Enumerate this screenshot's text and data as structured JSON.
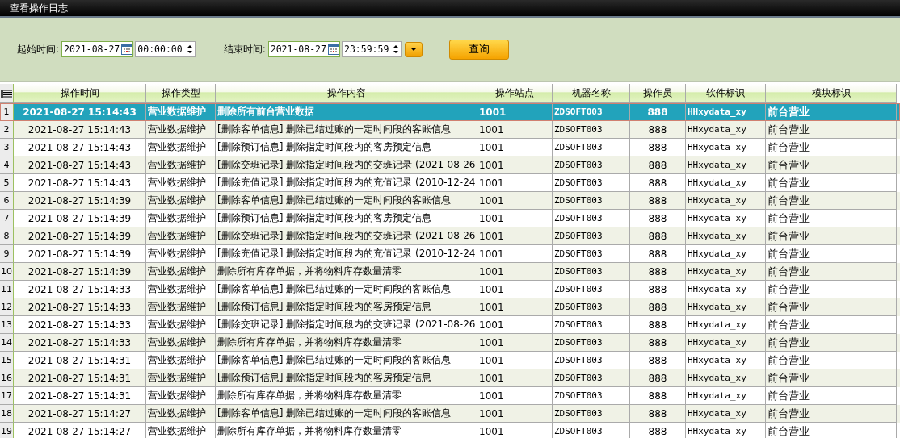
{
  "window": {
    "title": "查看操作日志"
  },
  "filter": {
    "start_label": "起始时间:",
    "start_date": "2021-08-27",
    "start_time": "00:00:00",
    "end_label": "结束时间:",
    "end_date": "2021-08-27",
    "end_time": "23:59:59",
    "query_button": "查询"
  },
  "table": {
    "columns": [
      "操作时间",
      "操作类型",
      "操作内容",
      "操作站点",
      "机器名称",
      "操作员",
      "软件标识",
      "模块标识"
    ],
    "rows": [
      {
        "num": "1",
        "selected": true,
        "cells": [
          "2021-08-27  15:14:43",
          "营业数据维护",
          "删除所有前台营业数据",
          "1001",
          "ZDSOFT003",
          "888",
          "HHxydata_xy",
          "前台营业"
        ]
      },
      {
        "num": "2",
        "selected": false,
        "cells": [
          "2021-08-27  15:14:43",
          "营业数据维护",
          "[删除客单信息] 删除已结过账的一定时间段的客账信息",
          "1001",
          "ZDSOFT003",
          "888",
          "HHxydata_xy",
          "前台营业"
        ]
      },
      {
        "num": "3",
        "selected": false,
        "cells": [
          "2021-08-27  15:14:43",
          "营业数据维护",
          "[删除预订信息] 删除指定时间段内的客房预定信息",
          "1001",
          "ZDSOFT003",
          "888",
          "HHxydata_xy",
          "前台营业"
        ]
      },
      {
        "num": "4",
        "selected": false,
        "cells": [
          "2021-08-27  15:14:43",
          "营业数据维护",
          "[删除交班记录] 删除指定时间段内的交班记录 (2021-08-26",
          "1001",
          "ZDSOFT003",
          "888",
          "HHxydata_xy",
          "前台营业"
        ]
      },
      {
        "num": "5",
        "selected": false,
        "cells": [
          "2021-08-27  15:14:43",
          "营业数据维护",
          "[删除充值记录] 删除指定时间段内的充值记录 (2010-12-24",
          "1001",
          "ZDSOFT003",
          "888",
          "HHxydata_xy",
          "前台营业"
        ]
      },
      {
        "num": "6",
        "selected": false,
        "cells": [
          "2021-08-27  15:14:39",
          "营业数据维护",
          "[删除客单信息] 删除已结过账的一定时间段的客账信息",
          "1001",
          "ZDSOFT003",
          "888",
          "HHxydata_xy",
          "前台营业"
        ]
      },
      {
        "num": "7",
        "selected": false,
        "cells": [
          "2021-08-27  15:14:39",
          "营业数据维护",
          "[删除预订信息] 删除指定时间段内的客房预定信息",
          "1001",
          "ZDSOFT003",
          "888",
          "HHxydata_xy",
          "前台营业"
        ]
      },
      {
        "num": "8",
        "selected": false,
        "cells": [
          "2021-08-27  15:14:39",
          "营业数据维护",
          "[删除交班记录] 删除指定时间段内的交班记录 (2021-08-26",
          "1001",
          "ZDSOFT003",
          "888",
          "HHxydata_xy",
          "前台营业"
        ]
      },
      {
        "num": "9",
        "selected": false,
        "cells": [
          "2021-08-27  15:14:39",
          "营业数据维护",
          "[删除充值记录] 删除指定时间段内的充值记录 (2010-12-24",
          "1001",
          "ZDSOFT003",
          "888",
          "HHxydata_xy",
          "前台营业"
        ]
      },
      {
        "num": "10",
        "selected": false,
        "cells": [
          "2021-08-27  15:14:39",
          "营业数据维护",
          "删除所有库存单据，并将物料库存数量清零",
          "1001",
          "ZDSOFT003",
          "888",
          "HHxydata_xy",
          "前台营业"
        ]
      },
      {
        "num": "11",
        "selected": false,
        "cells": [
          "2021-08-27  15:14:33",
          "营业数据维护",
          "[删除客单信息] 删除已结过账的一定时间段的客账信息",
          "1001",
          "ZDSOFT003",
          "888",
          "HHxydata_xy",
          "前台营业"
        ]
      },
      {
        "num": "12",
        "selected": false,
        "cells": [
          "2021-08-27  15:14:33",
          "营业数据维护",
          "[删除预订信息] 删除指定时间段内的客房预定信息",
          "1001",
          "ZDSOFT003",
          "888",
          "HHxydata_xy",
          "前台营业"
        ]
      },
      {
        "num": "13",
        "selected": false,
        "cells": [
          "2021-08-27  15:14:33",
          "营业数据维护",
          "[删除交班记录] 删除指定时间段内的交班记录 (2021-08-26",
          "1001",
          "ZDSOFT003",
          "888",
          "HHxydata_xy",
          "前台营业"
        ]
      },
      {
        "num": "14",
        "selected": false,
        "cells": [
          "2021-08-27  15:14:33",
          "营业数据维护",
          "删除所有库存单据，并将物料库存数量清零",
          "1001",
          "ZDSOFT003",
          "888",
          "HHxydata_xy",
          "前台营业"
        ]
      },
      {
        "num": "15",
        "selected": false,
        "cells": [
          "2021-08-27  15:14:31",
          "营业数据维护",
          "[删除客单信息] 删除已结过账的一定时间段的客账信息",
          "1001",
          "ZDSOFT003",
          "888",
          "HHxydata_xy",
          "前台营业"
        ]
      },
      {
        "num": "16",
        "selected": false,
        "cells": [
          "2021-08-27  15:14:31",
          "营业数据维护",
          "[删除预订信息] 删除指定时间段内的客房预定信息",
          "1001",
          "ZDSOFT003",
          "888",
          "HHxydata_xy",
          "前台营业"
        ]
      },
      {
        "num": "17",
        "selected": false,
        "cells": [
          "2021-08-27  15:14:31",
          "营业数据维护",
          "删除所有库存单据，并将物料库存数量清零",
          "1001",
          "ZDSOFT003",
          "888",
          "HHxydata_xy",
          "前台营业"
        ]
      },
      {
        "num": "18",
        "selected": false,
        "cells": [
          "2021-08-27  15:14:27",
          "营业数据维护",
          "[删除客单信息] 删除已结过账的一定时间段的客账信息",
          "1001",
          "ZDSOFT003",
          "888",
          "HHxydata_xy",
          "前台营业"
        ]
      },
      {
        "num": "19",
        "selected": false,
        "cells": [
          "2021-08-27  15:14:27",
          "营业数据维护",
          "删除所有库存单据，并将物料库存数量清零",
          "1001",
          "ZDSOFT003",
          "888",
          "HHxydata_xy",
          "前台营业"
        ]
      }
    ]
  }
}
